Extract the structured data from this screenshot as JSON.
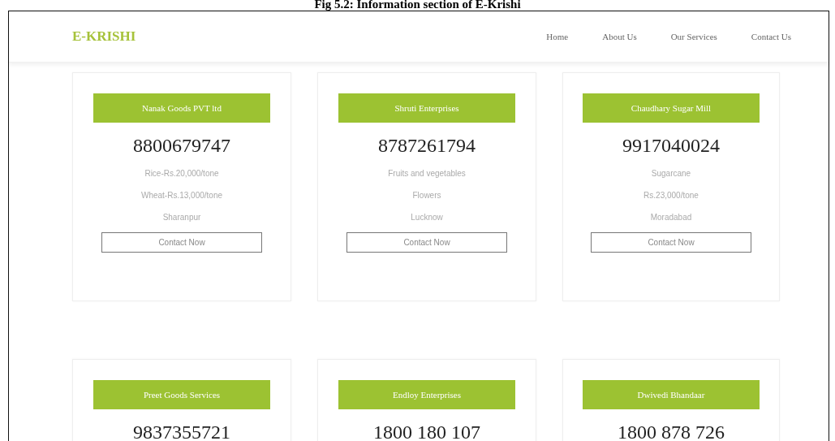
{
  "caption": "Fig 5.2: Information section of E-Krishi",
  "header": {
    "logo": "E-KRISHI",
    "nav": [
      "Home",
      "About Us",
      "Our Services",
      "Contact Us"
    ]
  },
  "cards": [
    {
      "name": "Nanak Goods PVT ltd",
      "phone": "8800679747",
      "lines": [
        "Rice-Rs.20,000/tone",
        "Wheat-Rs.13,000/tone",
        "Sharanpur"
      ],
      "button": "Contact Now"
    },
    {
      "name": "Shruti Enterprises",
      "phone": "8787261794",
      "lines": [
        "Fruits and vegetables",
        "Flowers",
        "Lucknow"
      ],
      "button": "Contact Now"
    },
    {
      "name": "Chaudhary Sugar Mill",
      "phone": "9917040024",
      "lines": [
        "Sugarcane",
        "Rs.23,000/tone",
        "Moradabad"
      ],
      "button": "Contact Now"
    },
    {
      "name": "Preet Goods Services",
      "phone": "9837355721"
    },
    {
      "name": "Endloy Enterprises",
      "phone": "1800 180 107"
    },
    {
      "name": "Dwivedi Bhandaar",
      "phone": "1800 878 726"
    }
  ]
}
